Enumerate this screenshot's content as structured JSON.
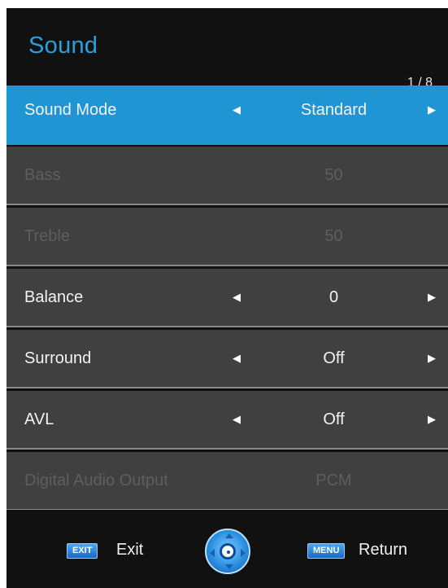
{
  "header": {
    "title": "Sound",
    "page_indicator": "1 / 8"
  },
  "menu": {
    "items": [
      {
        "label": "Sound Mode",
        "value": "Standard",
        "state": "selected",
        "arrow_left": "◀",
        "arrow_right": "▶"
      },
      {
        "label": "Bass",
        "value": "50",
        "state": "disabled"
      },
      {
        "label": "Treble",
        "value": "50",
        "state": "disabled"
      },
      {
        "label": "Balance",
        "value": "0",
        "state": "normal",
        "arrow_left": "◀",
        "arrow_right": "▶"
      },
      {
        "label": "Surround",
        "value": "Off",
        "state": "normal",
        "arrow_left": "◀",
        "arrow_right": "▶"
      },
      {
        "label": "AVL",
        "value": "Off",
        "state": "normal",
        "arrow_left": "◀",
        "arrow_right": "▶"
      },
      {
        "label": "Digital Audio Output",
        "value": "PCM",
        "state": "disabled"
      }
    ]
  },
  "footer": {
    "exit_key": "EXIT",
    "exit_label": "Exit",
    "menu_key": "MENU",
    "return_label": "Return",
    "nav_icon": "navigation-pad-icon"
  },
  "colors": {
    "accent": "#2aa0db",
    "selected_row": "#1f95d3",
    "row_bg": "#404040",
    "panel_bg": "#111111",
    "disabled_text": "#5e5e5e"
  }
}
